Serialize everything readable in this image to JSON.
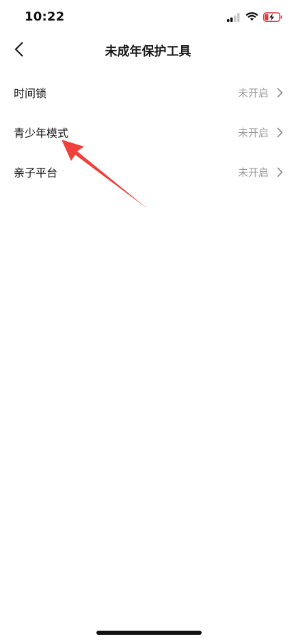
{
  "status_bar": {
    "time": "10:22",
    "signal_icon": "cellular-signal-icon",
    "wifi_icon": "wifi-icon",
    "battery_icon": "battery-low-charging-icon",
    "battery_level": 0.2,
    "battery_color": "#e0383e"
  },
  "nav": {
    "back_icon": "chevron-left-icon",
    "title": "未成年保护工具"
  },
  "list": {
    "items": [
      {
        "label": "时间锁",
        "status": "未开启"
      },
      {
        "label": "青少年模式",
        "status": "未开启"
      },
      {
        "label": "亲子平台",
        "status": "未开启"
      }
    ],
    "chevron_icon": "chevron-right-icon"
  },
  "annotation": {
    "type": "arrow",
    "color": "#f0403c",
    "points_to": "青少年模式"
  },
  "colors": {
    "background": "#ffffff",
    "text_primary": "#161616",
    "text_secondary": "#9a9a9a"
  }
}
